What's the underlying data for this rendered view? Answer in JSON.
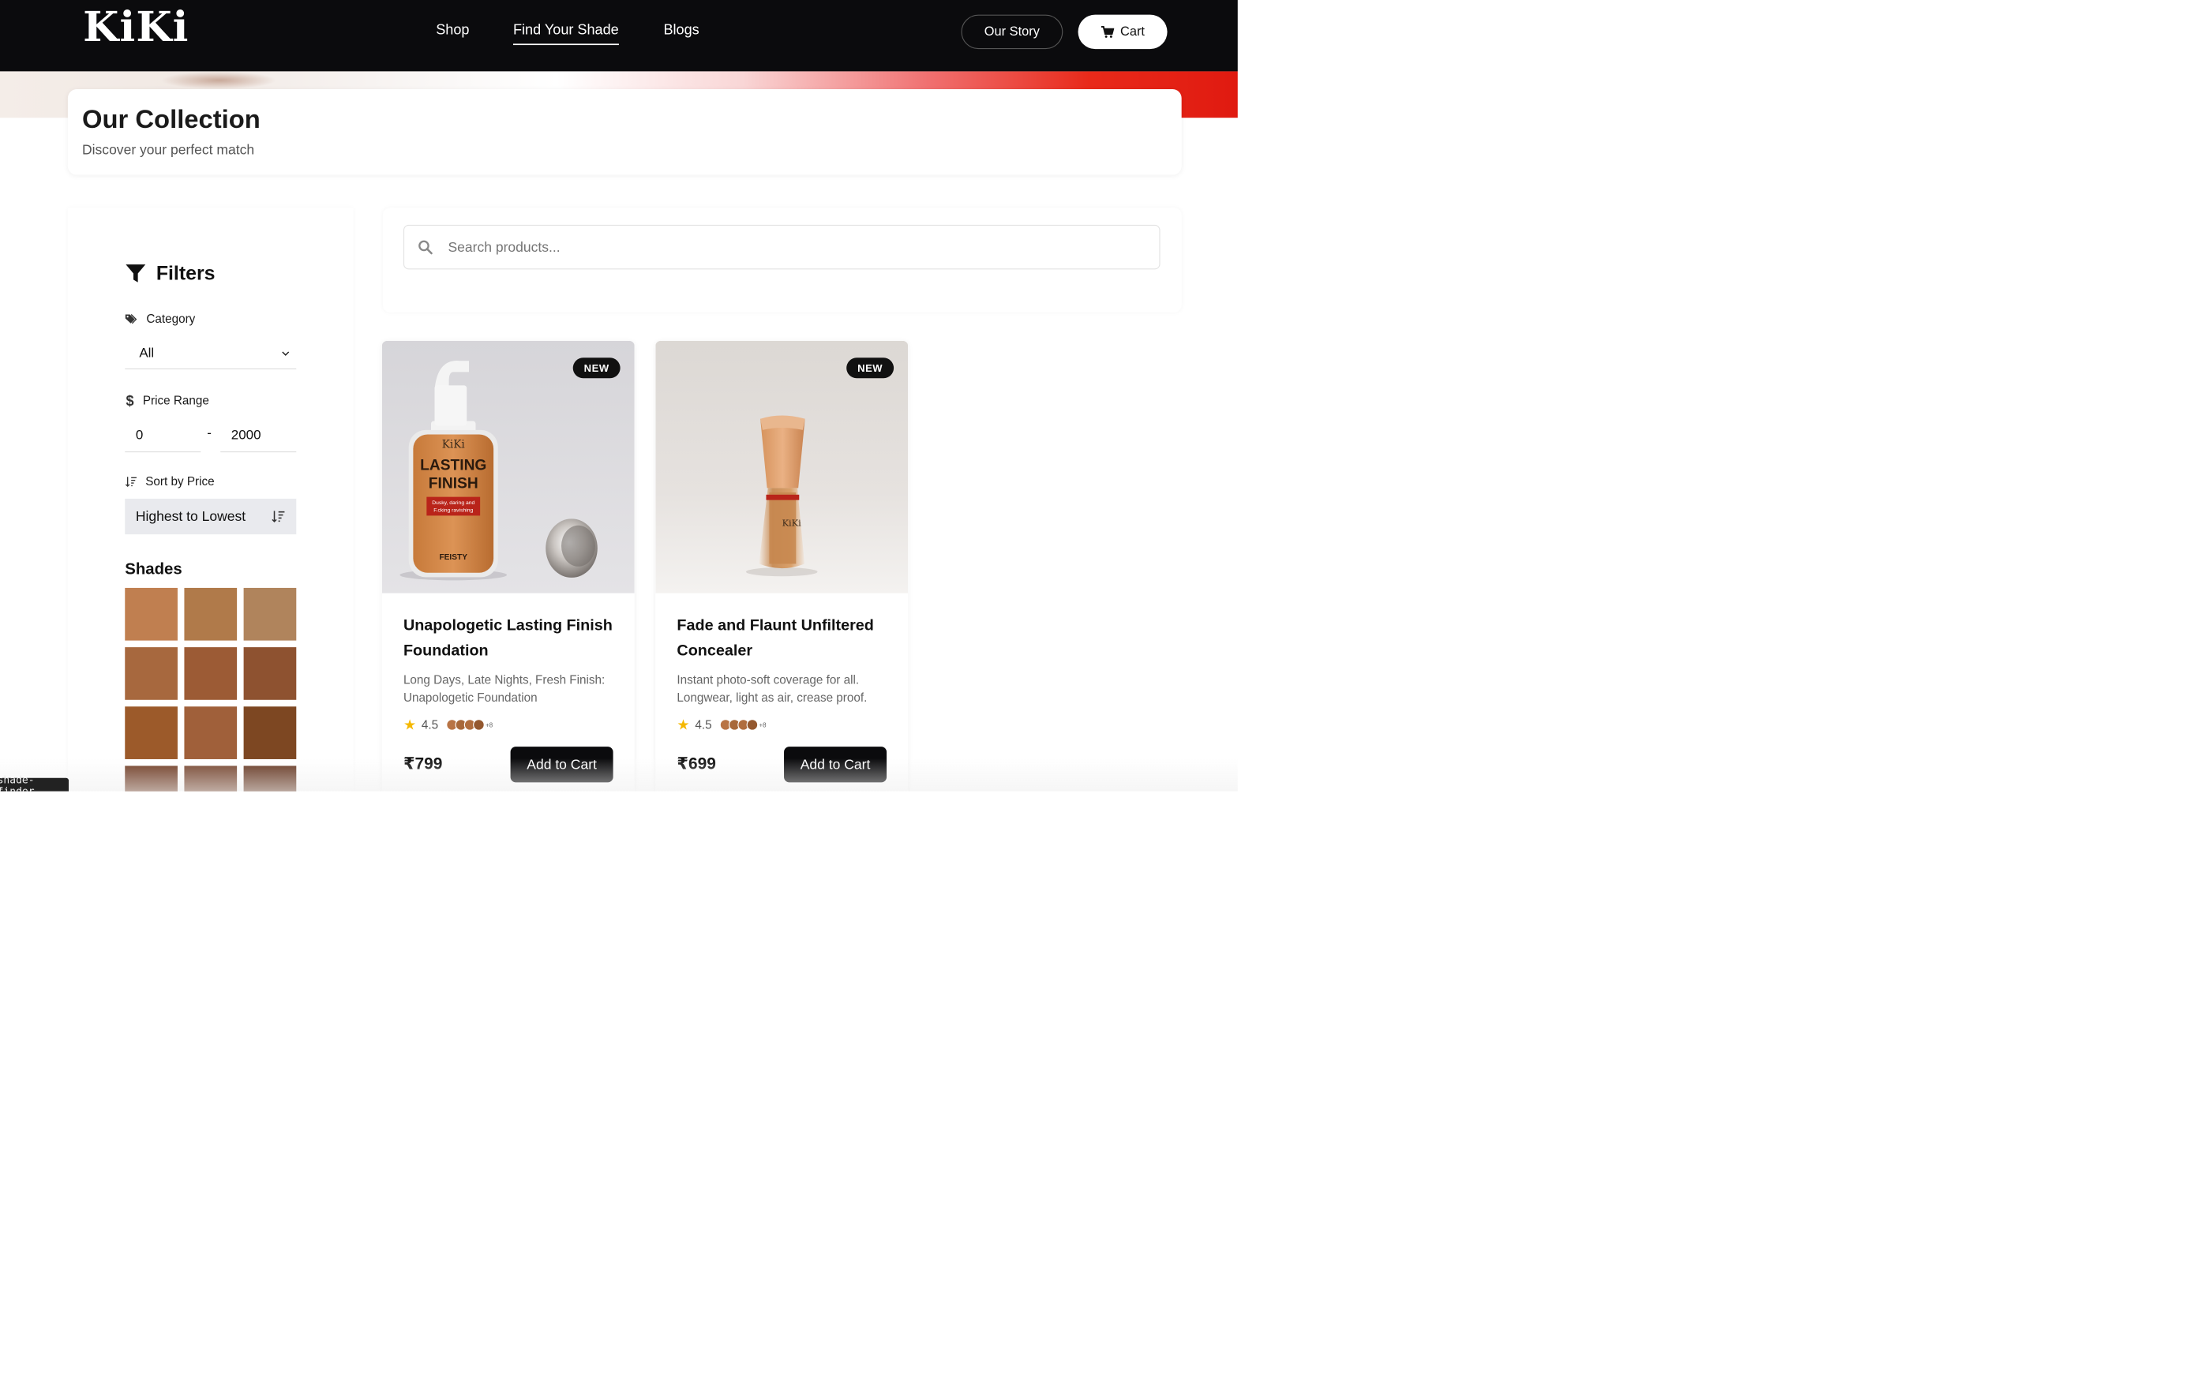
{
  "nav": {
    "logo": "KiKi",
    "links": [
      "Shop",
      "Find Your Shade",
      "Blogs"
    ],
    "our_story": "Our Story",
    "cart": "Cart"
  },
  "collection": {
    "title": "Our Collection",
    "subtitle": "Discover your perfect match"
  },
  "filters": {
    "title": "Filters",
    "category_label": "Category",
    "category_value": "All",
    "price_label": "Price Range",
    "price_min": "0",
    "price_sep": "-",
    "price_max": "2000",
    "sort_label": "Sort by Price",
    "sort_value": "Highest to Lowest",
    "shades_title": "Shades",
    "shade_colors": [
      "#c07f50",
      "#b07a4a",
      "#b0845c",
      "#a7683e",
      "#9c5b35",
      "#8e5230",
      "#9c5a2a",
      "#a0603a",
      "#7d4722",
      "#6e3a22",
      "#74432c",
      "#643620"
    ]
  },
  "search": {
    "placeholder": "Search products..."
  },
  "products": [
    {
      "badge": "NEW",
      "title": "Unapologetic Lasting Finish Foundation",
      "description": "Long Days, Late Nights, Fresh Finish: Unapologetic Foundation",
      "rating": "4.5",
      "more_shades": "+8",
      "price": "₹799",
      "add_label": "Add to Cart",
      "bottle_lines": [
        "KiKi",
        "LASTING",
        "FINISH",
        "Dusky, daring and",
        "F.cking ravishing",
        "FEISTY"
      ]
    },
    {
      "badge": "NEW",
      "title": "Fade and Flaunt Unfiltered Concealer",
      "description": "Instant photo-soft coverage for all. Longwear, light as air, crease proof.",
      "rating": "4.5",
      "more_shades": "+8",
      "price": "₹699",
      "add_label": "Add to Cart",
      "bottle_lines": [
        "KiKi"
      ]
    }
  ],
  "tooltip": "shade-finder",
  "colors": {
    "nav_bg": "#0b0b0d",
    "accent_red": "#e01a10",
    "sort_bg": "#e9eaee",
    "star": "#f5b800"
  }
}
